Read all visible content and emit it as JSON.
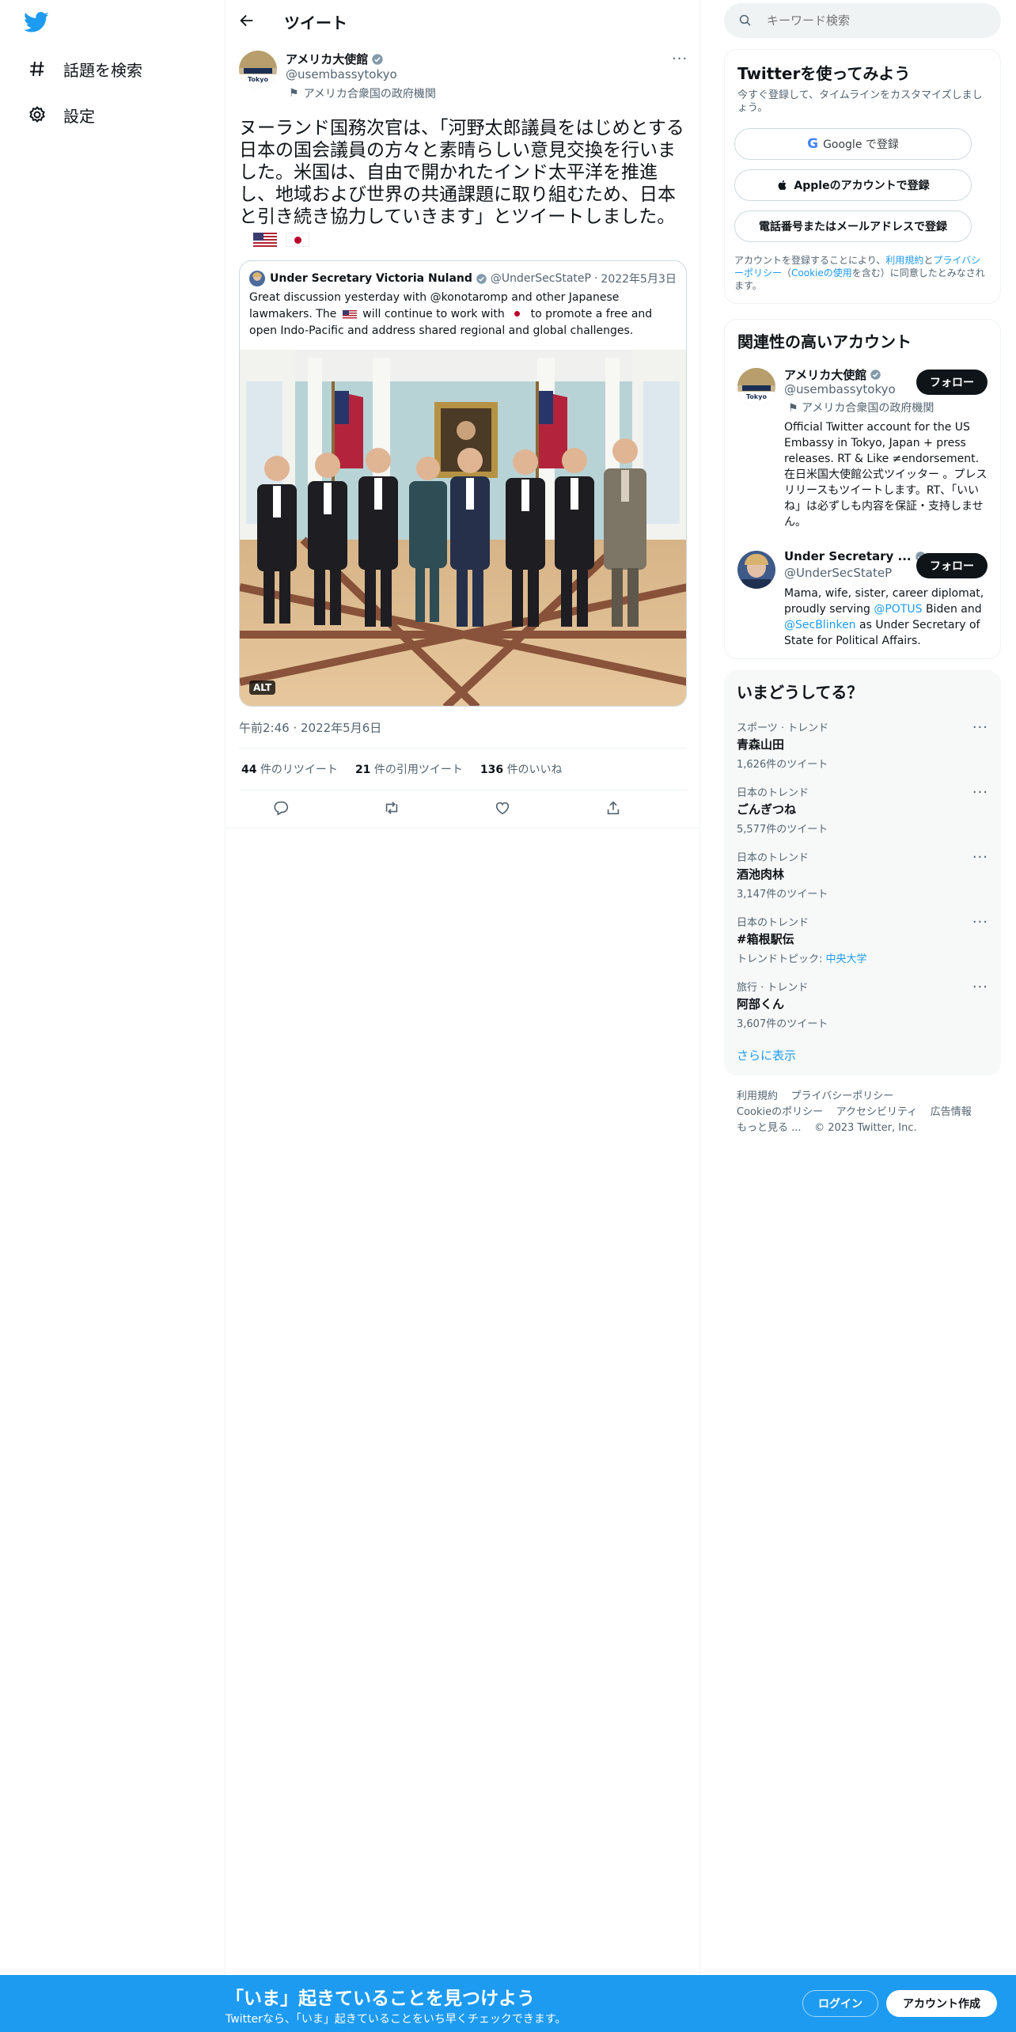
{
  "nav": {
    "items": [
      {
        "label": "話題を検索",
        "icon": "hashtag-icon"
      },
      {
        "label": "設定",
        "icon": "gear-icon"
      }
    ]
  },
  "header": {
    "title": "ツイート"
  },
  "tweet": {
    "author_name": "アメリカ大使館",
    "author_handle": "@usembassytokyo",
    "affiliation": "アメリカ合衆国の政府機関",
    "avatar_text": "Tokyo",
    "text": "ヌーランド国務次官は、「河野太郎議員をはじめとする日本の国会議員の方々と素晴らしい意見交換を行いました。米国は、自由で開かれたインド太平洋を推進し、地域および世界の共通課題に取り組むため、日本と引き続き協力していきます」とツイートしました。",
    "quote": {
      "author_name": "Under Secretary Victoria Nuland",
      "author_handle": "@UnderSecStateP",
      "date": "2022年5月3日",
      "text_1": "Great discussion yesterday with @konotaromp and other Japanese lawmakers. The",
      "text_2": "will continue to work with",
      "text_3": "to promote a free and open Indo-Pacific and address shared regional and global challenges.",
      "alt_badge": "ALT"
    },
    "timestamp": "午前2:46 · 2022年5月6日",
    "stats": {
      "retweets_num": "44",
      "retweets_label": "件のリツイート",
      "quotes_num": "21",
      "quotes_label": "件の引用ツイート",
      "likes_num": "136",
      "likes_label": "件のいいね"
    }
  },
  "search": {
    "placeholder": "キーワード検索"
  },
  "signup": {
    "title": "Twitterを使ってみよう",
    "subtitle": "今すぐ登録して、タイムラインをカスタマイズしましょう。",
    "google_label": "Google で登録",
    "apple_label": "Appleのアカウントで登録",
    "phone_label": "電話番号またはメールアドレスで登録",
    "legal_1": "アカウントを登録することにより、",
    "legal_terms": "利用規約",
    "legal_2": "と",
    "legal_privacy": "プライバシーポリシー",
    "legal_3": "（",
    "legal_cookie": "Cookieの使用",
    "legal_4": "を含む）に同意したとみなされます。"
  },
  "related": {
    "title": "関連性の高いアカウント",
    "accounts": [
      {
        "name": "アメリカ大使館",
        "handle": "@usembassytokyo",
        "affiliation": "アメリカ合衆国の政府機関",
        "bio": "Official Twitter account for the US Embassy in Tokyo, Japan + press releases. RT & Like ≠endorsement. 在日米国大使館公式ツイッター 。プレスリリースもツイートします。RT、「いいね」は必ずしも内容を保証・支持しません。",
        "follow_label": "フォロー"
      },
      {
        "name": "Under Secretary ...",
        "handle": "@UnderSecStateP",
        "bio_1": "Mama, wife, sister, career diplomat, proudly serving ",
        "bio_link_1": "@POTUS",
        "bio_2": " Biden and ",
        "bio_link_2": "@SecBlinken",
        "bio_3": " as Under Secretary of State for Political Affairs.",
        "follow_label": "フォロー"
      }
    ]
  },
  "trends": {
    "title": "いまどうしてる？",
    "items": [
      {
        "category": "スポーツ · トレンド",
        "name": "青森山田",
        "count": "1,626件のツイート"
      },
      {
        "category": "日本のトレンド",
        "name": "ごんぎつね",
        "count": "5,577件のツイート"
      },
      {
        "category": "日本のトレンド",
        "name": "酒池肉林",
        "count": "3,147件のツイート"
      },
      {
        "category": "日本のトレンド",
        "name": "#箱根駅伝",
        "count_prefix": "トレンドトピック: ",
        "count_link": "中央大学"
      },
      {
        "category": "旅行 · トレンド",
        "name": "阿部くん",
        "count": "3,607件のツイート"
      }
    ],
    "show_more": "さらに表示"
  },
  "footer": {
    "links": [
      "利用規約",
      "プライバシーポリシー",
      "Cookieのポリシー",
      "アクセシビリティ",
      "広告情報",
      "もっと見る ..."
    ],
    "copyright": "© 2023 Twitter, Inc."
  },
  "banner": {
    "title": "「いま」起きていることを見つけよう",
    "subtitle": "Twitterなら、「いま」起きていることをいち早くチェックできます。",
    "login_label": "ログイン",
    "signup_label": "アカウント作成"
  },
  "colors": {
    "accent": "#1d9bf0",
    "text": "#0f1419",
    "secondary": "#536471",
    "card": "#f7f9f9"
  }
}
